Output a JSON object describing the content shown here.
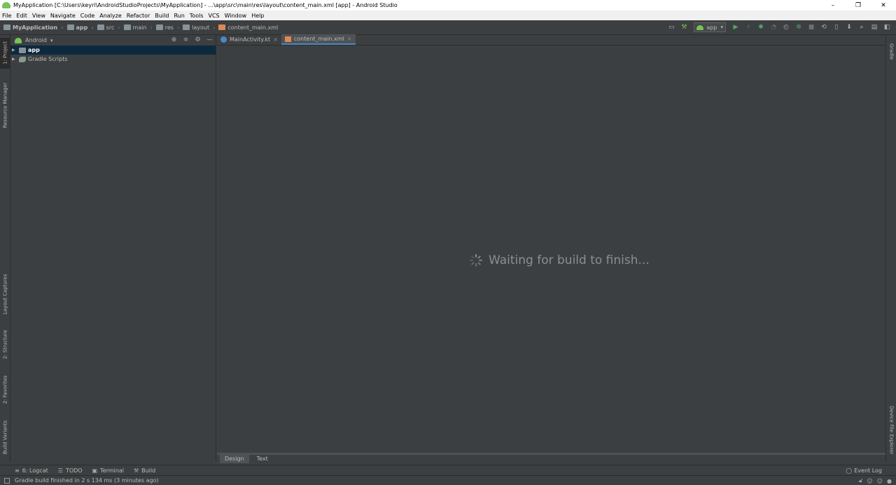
{
  "window": {
    "title": "MyApplication [C:\\Users\\keyri\\AndroidStudioProjects\\MyApplication] - ...\\app\\src\\main\\res\\layout\\content_main.xml [app] - Android Studio",
    "minimize": "–",
    "restore": "❐",
    "close": "✕"
  },
  "menu": [
    "File",
    "Edit",
    "View",
    "Navigate",
    "Code",
    "Analyze",
    "Refactor",
    "Build",
    "Run",
    "Tools",
    "VCS",
    "Window",
    "Help"
  ],
  "breadcrumbs": [
    "MyApplication",
    "app",
    "src",
    "main",
    "res",
    "layout",
    "content_main.xml"
  ],
  "toolbar": {
    "run_config": "app",
    "icons": [
      "layout-editor-icon",
      "build-hammer-icon",
      "run-config-icon",
      "run-icon",
      "apply-changes-icon",
      "debug-icon",
      "coverage-icon",
      "profile-icon",
      "attach-debugger-icon",
      "stop-icon",
      "sync-gradle-icon",
      "avd-manager-icon",
      "sdk-manager-icon",
      "search-icon",
      "project-structure-icon",
      "toggle-panel-icon"
    ]
  },
  "left_stripe": {
    "project": "1: Project",
    "resource_manager": "Resource Manager",
    "layout_captures": "Layout Captures",
    "structure": "2: Structure",
    "favorites": "2: Favorites",
    "build_variants": "Build Variants"
  },
  "right_stripe": {
    "gradle": "Gradle",
    "device_file_explorer": "Device File Explorer"
  },
  "project_panel": {
    "view": "Android",
    "tree": [
      {
        "label": "app",
        "selected": true
      },
      {
        "label": "Gradle Scripts",
        "selected": false
      }
    ]
  },
  "editor": {
    "tabs": [
      {
        "label": "MainActivity.kt",
        "active": false
      },
      {
        "label": "content_main.xml",
        "active": true
      }
    ],
    "waiting_message": "Waiting for build to finish...",
    "bottom_tabs": [
      {
        "label": "Design",
        "active": true
      },
      {
        "label": "Text",
        "active": false
      }
    ]
  },
  "bottom_tools": {
    "logcat": "6: Logcat",
    "todo": "TODO",
    "terminal": "Terminal",
    "build": "Build",
    "event_log": "Event Log"
  },
  "status": {
    "message": "Gradle build finished in 2 s 134 ms (3 minutes ago)"
  },
  "colors": {
    "background": "#3c3f41",
    "selection": "#0d293e",
    "accent": "#4a88c7",
    "android_green": "#78c257"
  }
}
